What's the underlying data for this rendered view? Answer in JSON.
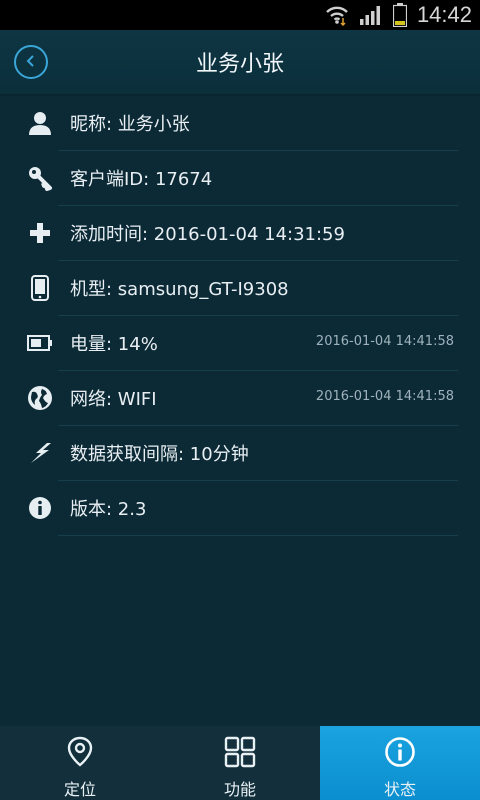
{
  "status_bar": {
    "time": "14:42",
    "icons": [
      "wifi-icon",
      "signal-icon",
      "battery-icon"
    ]
  },
  "header": {
    "title": "业务小张",
    "back_icon": "back-icon"
  },
  "info_rows": [
    {
      "icon": "user-icon",
      "label": "昵称:  业务小张",
      "time": ""
    },
    {
      "icon": "key-icon",
      "label": "客户端ID:  17674",
      "time": ""
    },
    {
      "icon": "plus-icon",
      "label": "添加时间:  2016-01-04 14:31:59",
      "time": ""
    },
    {
      "icon": "phone-icon",
      "label": "机型:  samsung_GT-I9308",
      "time": ""
    },
    {
      "icon": "battery-icon",
      "label": "电量:  14%",
      "time": "2016-01-04 14:41:58"
    },
    {
      "icon": "globe-icon",
      "label": "网络:  WIFI",
      "time": "2016-01-04 14:41:58"
    },
    {
      "icon": "lightning-icon",
      "label": "数据获取间隔:  10分钟",
      "time": ""
    },
    {
      "icon": "info-icon",
      "label": "版本:  2.3",
      "time": ""
    }
  ],
  "tabs": [
    {
      "label": "定位",
      "icon": "location-pin-icon",
      "active": false
    },
    {
      "label": "功能",
      "icon": "grid-icon",
      "active": false
    },
    {
      "label": "状态",
      "icon": "info-icon",
      "active": true
    }
  ],
  "colors": {
    "background": "#0b2a36",
    "accent": "#1aa3e0",
    "text": "#e6eef2",
    "muted_text": "#9fb2bb"
  }
}
